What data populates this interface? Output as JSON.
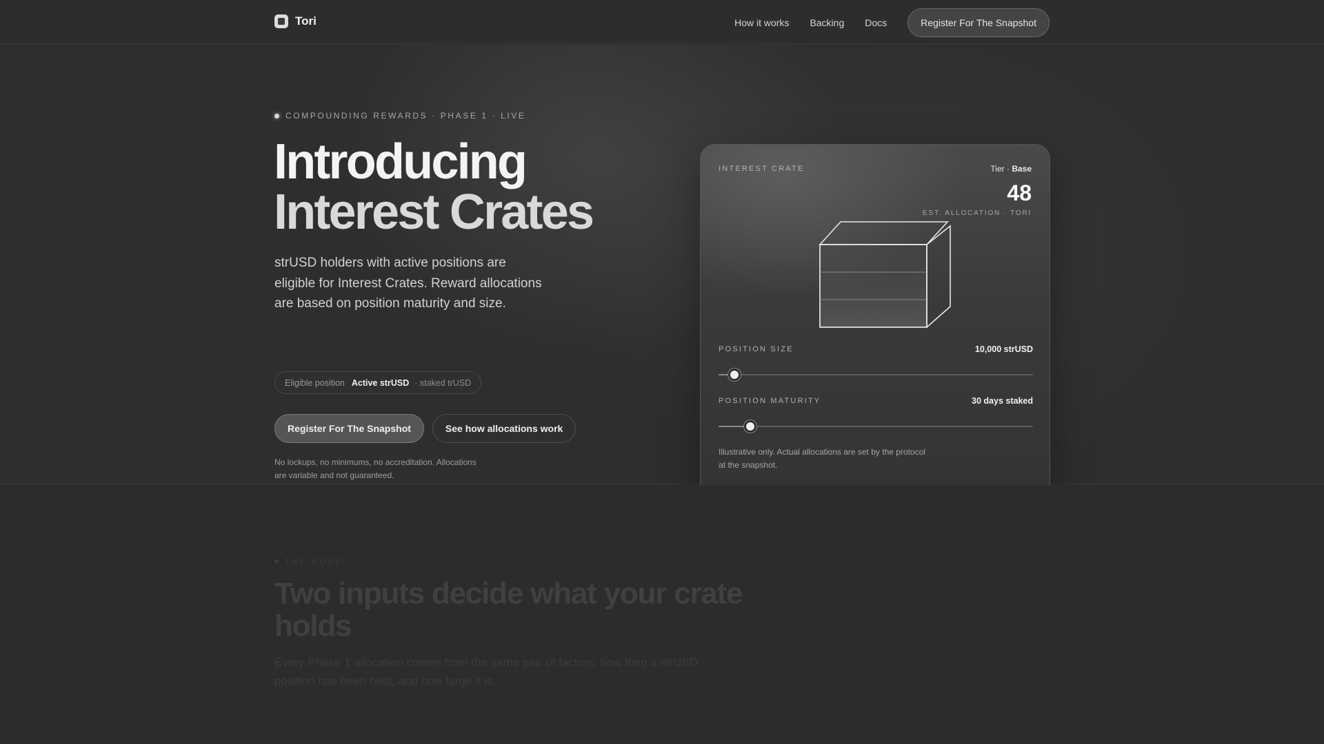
{
  "header": {
    "brand": "Tori",
    "nav": [
      "How it works",
      "Backing",
      "Docs"
    ],
    "cta": "Register For The Snapshot"
  },
  "hero": {
    "eyebrow": "COMPOUNDING REWARDS · PHASE 1 · LIVE",
    "title_line1": "Introducing",
    "title_line2": "Interest Crates",
    "lead": "strUSD holders with active positions are eligible for Interest Crates. Reward allocations are based on position maturity and size.",
    "pill": {
      "label": "Eligible position",
      "value": "Active strUSD",
      "extra": "· staked trUSD"
    },
    "primary_cta": "Register For The Snapshot",
    "secondary_cta": "See how allocations work",
    "fineprint": "No lockups, no minimums, no accreditation. Allocations are variable and not guaranteed."
  },
  "card": {
    "label": "INTEREST CRATE",
    "tier_prefix": "Tier · ",
    "tier_value": "Base",
    "value": "48",
    "value_caption": "EST. ALLOCATION · TORI",
    "position_size": {
      "label": "POSITION SIZE",
      "value": "10,000 strUSD",
      "level": 0.05
    },
    "position_maturity": {
      "label": "POSITION MATURITY",
      "value": "30 days staked",
      "level": 0.1
    },
    "note": "Illustrative only. Actual allocations are set by the protocol at the snapshot."
  },
  "section2": {
    "eyebrow": "THE MODEL",
    "title": "Two inputs decide what your crate holds",
    "body": "Every Phase 1 allocation comes from the same pair of factors: how long a strUSD position has been held, and how large it is."
  },
  "icons": {
    "brand": "tori-logo-icon",
    "crate": "crate-icon"
  }
}
